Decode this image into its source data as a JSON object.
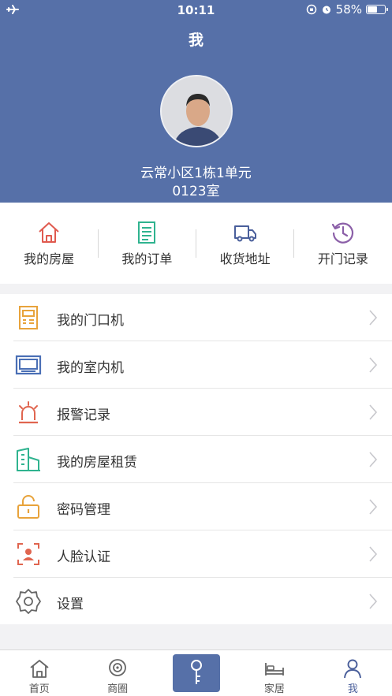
{
  "status_bar": {
    "time": "10:11",
    "battery": "58%",
    "battery_level": 0.58
  },
  "header": {
    "title": "我",
    "address_line1": "云常小区1栋1单元",
    "address_line2": "0123室"
  },
  "quick_actions": [
    {
      "label": "我的房屋",
      "icon": "house-icon",
      "color": "#e05a4f"
    },
    {
      "label": "我的订单",
      "icon": "order-list-icon",
      "color": "#2fb38f"
    },
    {
      "label": "收货地址",
      "icon": "delivery-truck-icon",
      "color": "#4a5f9b"
    },
    {
      "label": "开门记录",
      "icon": "history-clock-icon",
      "color": "#8b5fa8"
    }
  ],
  "menu": [
    {
      "label": "我的门口机",
      "icon": "door-intercom-icon",
      "color": "#e8a33b"
    },
    {
      "label": "我的室内机",
      "icon": "indoor-monitor-icon",
      "color": "#4a6fb5"
    },
    {
      "label": "报警记录",
      "icon": "alarm-light-icon",
      "color": "#e0654f"
    },
    {
      "label": "我的房屋租赁",
      "icon": "building-rental-icon",
      "color": "#2fb38f"
    },
    {
      "label": "密码管理",
      "icon": "padlock-icon",
      "color": "#e8a33b"
    },
    {
      "label": "人脸认证",
      "icon": "face-scan-icon",
      "color": "#e0654f"
    },
    {
      "label": "设置",
      "icon": "gear-icon",
      "color": "#666666"
    }
  ],
  "tabbar": [
    {
      "label": "首页",
      "icon": "home-icon"
    },
    {
      "label": "商圈",
      "icon": "location-target-icon"
    },
    {
      "label": "",
      "icon": "key-icon"
    },
    {
      "label": "家居",
      "icon": "bed-icon"
    },
    {
      "label": "我",
      "icon": "person-icon",
      "active": true
    }
  ],
  "colors": {
    "header_bg": "#5670a8",
    "tab_active": "#4a5f9b"
  }
}
